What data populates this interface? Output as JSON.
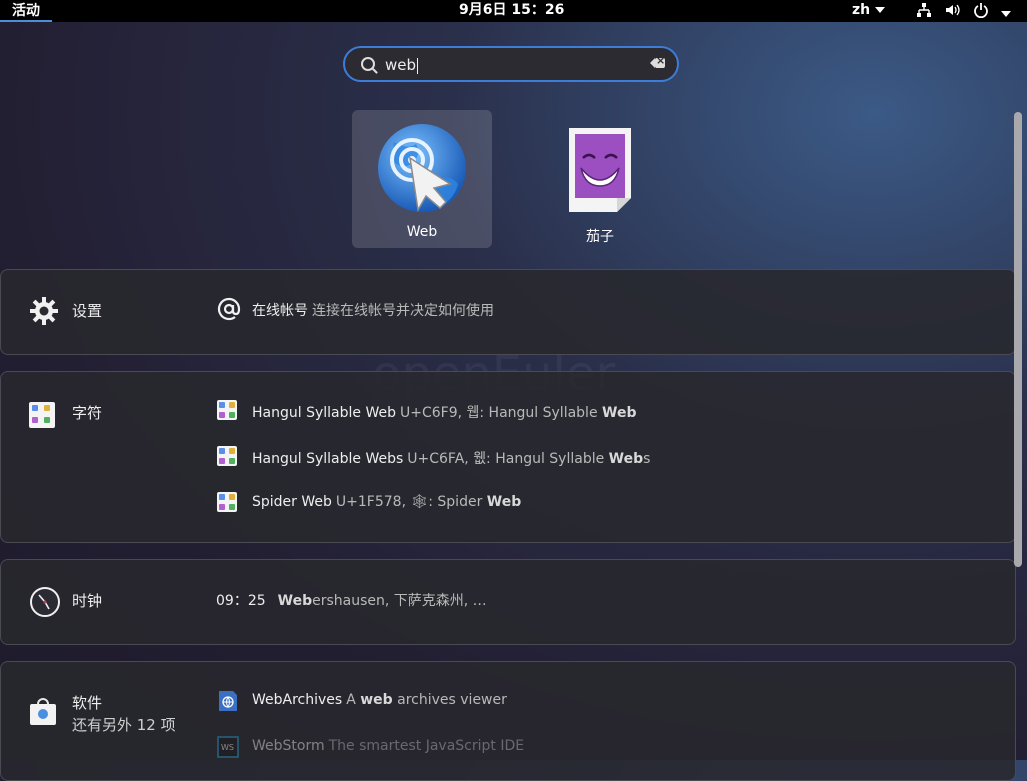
{
  "topbar": {
    "activities": "活动",
    "datetime": "9月6日  15：26",
    "lang": "zh",
    "icons": [
      "network-icon",
      "volume-icon",
      "power-icon",
      "chevron-down-icon"
    ]
  },
  "search": {
    "value": "web"
  },
  "apps": [
    {
      "name": "Web",
      "icon": "web-browser-icon"
    },
    {
      "name": "茄子",
      "icon": "cheese-icon"
    }
  ],
  "watermark": "openEuler",
  "settings": {
    "title": "设置",
    "item_title": "在线帐号",
    "item_desc": "连接在线帐号并决定如何使用"
  },
  "characters": {
    "title": "字符",
    "items": [
      {
        "title": "Hangul Syllable Web",
        "desc_pre": "U+C6F9, 웹: Hangul Syllable ",
        "desc_bold": "Web",
        "desc_post": ""
      },
      {
        "title": "Hangul Syllable Webs",
        "desc_pre": "U+C6FA, 웺: Hangul Syllable ",
        "desc_bold": "Web",
        "desc_post": "s"
      },
      {
        "title": "Spider Web",
        "desc_pre": "U+1F578, 🕸: Spider ",
        "desc_bold": "Web",
        "desc_post": ""
      }
    ]
  },
  "clock": {
    "title": "时钟",
    "time": "09：25",
    "bold": "Web",
    "rest": "ershausen, 下萨克森州, …"
  },
  "software": {
    "title": "软件",
    "more": "还有另外 12 项",
    "items": [
      {
        "title": "WebArchives",
        "desc_pre": "A ",
        "desc_bold": "web",
        "desc_post": " archives viewer"
      },
      {
        "title": "WebStorm",
        "desc_pre": "The smartest JavaScript IDE",
        "desc_bold": "",
        "desc_post": ""
      }
    ]
  },
  "colors": {
    "accent": "#3d7dd8",
    "topbar": "#000000"
  }
}
